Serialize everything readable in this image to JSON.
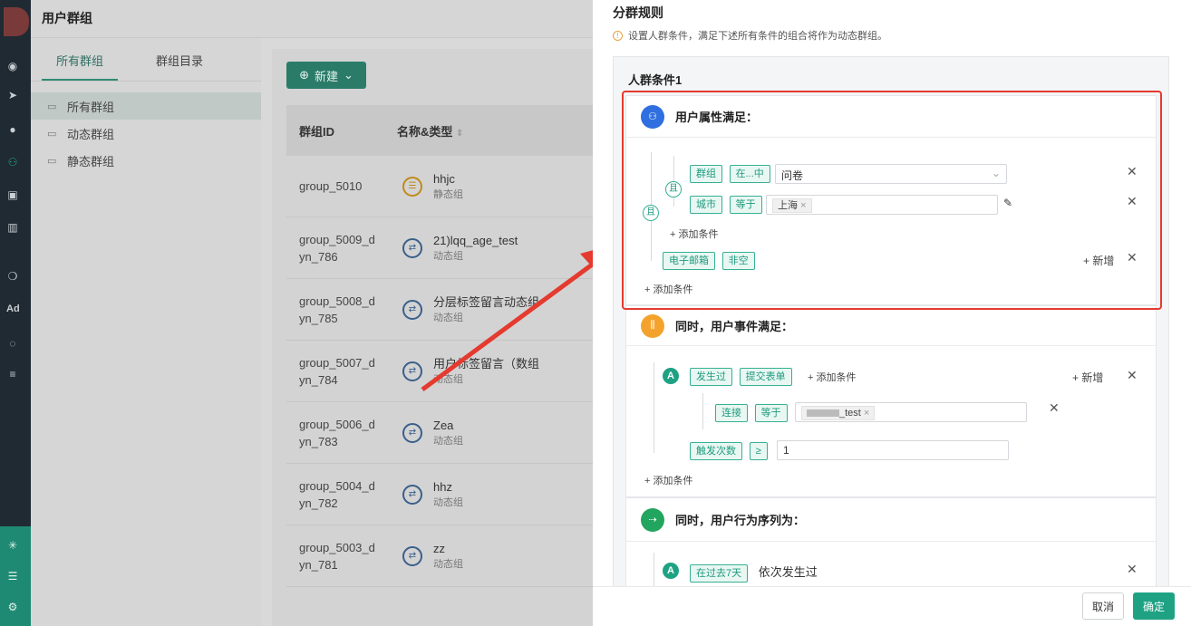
{
  "app": {
    "title": "用户群组",
    "tabs": [
      "所有群组",
      "群组目录"
    ],
    "tree": [
      "所有群组",
      "动态群组",
      "静态群组"
    ],
    "new_button": "新建",
    "columns": [
      "群组ID",
      "名称&类型"
    ],
    "rows": [
      {
        "id1": "group_5010",
        "id2": "",
        "name": "hhjc",
        "type": "静态组",
        "static": true
      },
      {
        "id1": "group_5009_d",
        "id2": "yn_786",
        "name": "21)lqq_age_test",
        "type": "动态组",
        "static": false
      },
      {
        "id1": "group_5008_d",
        "id2": "yn_785",
        "name": "分层标签留言动态组",
        "type": "动态组",
        "static": false
      },
      {
        "id1": "group_5007_d",
        "id2": "yn_784",
        "name": "用户标签留言（数组",
        "type": "动态组",
        "static": false
      },
      {
        "id1": "group_5006_d",
        "id2": "yn_783",
        "name": "Zea",
        "type": "动态组",
        "static": false
      },
      {
        "id1": "group_5004_d",
        "id2": "yn_782",
        "name": "hhz",
        "type": "动态组",
        "static": false
      },
      {
        "id1": "group_5003_d",
        "id2": "yn_781",
        "name": "zz",
        "type": "动态组",
        "static": false
      }
    ],
    "rail_ad": "Ad"
  },
  "drawer": {
    "title": "分群规则",
    "hint": "设置人群条件，满足下述所有条件的组合将作为动态群组。",
    "condition_title": "人群条件1",
    "and_label": "且",
    "add_condition": "+ 添加条件",
    "add_new": "+ 新增",
    "block1": {
      "title": "用户属性满足：",
      "r1": {
        "field": "群组",
        "op": "在...中",
        "value": "问卷"
      },
      "r2": {
        "field": "城市",
        "op": "等于",
        "chip": "上海"
      },
      "r3": {
        "field": "电子邮箱",
        "op": "非空"
      }
    },
    "block2": {
      "title": "同时，用户事件满足：",
      "letter": "A",
      "event_op": "发生过",
      "event": "提交表单",
      "sub": {
        "field": "连接",
        "op": "等于",
        "chip": "_test"
      },
      "count": {
        "field": "触发次数",
        "op": "≥",
        "value": "1"
      }
    },
    "block3": {
      "title": "同时，用户行为序列为：",
      "letter": "A",
      "period": "在过去7天",
      "text": "依次发生过"
    },
    "cancel": "取消",
    "ok": "确定"
  },
  "colors": {
    "accent": "#1fa284",
    "highlight": "#e53a2f"
  }
}
